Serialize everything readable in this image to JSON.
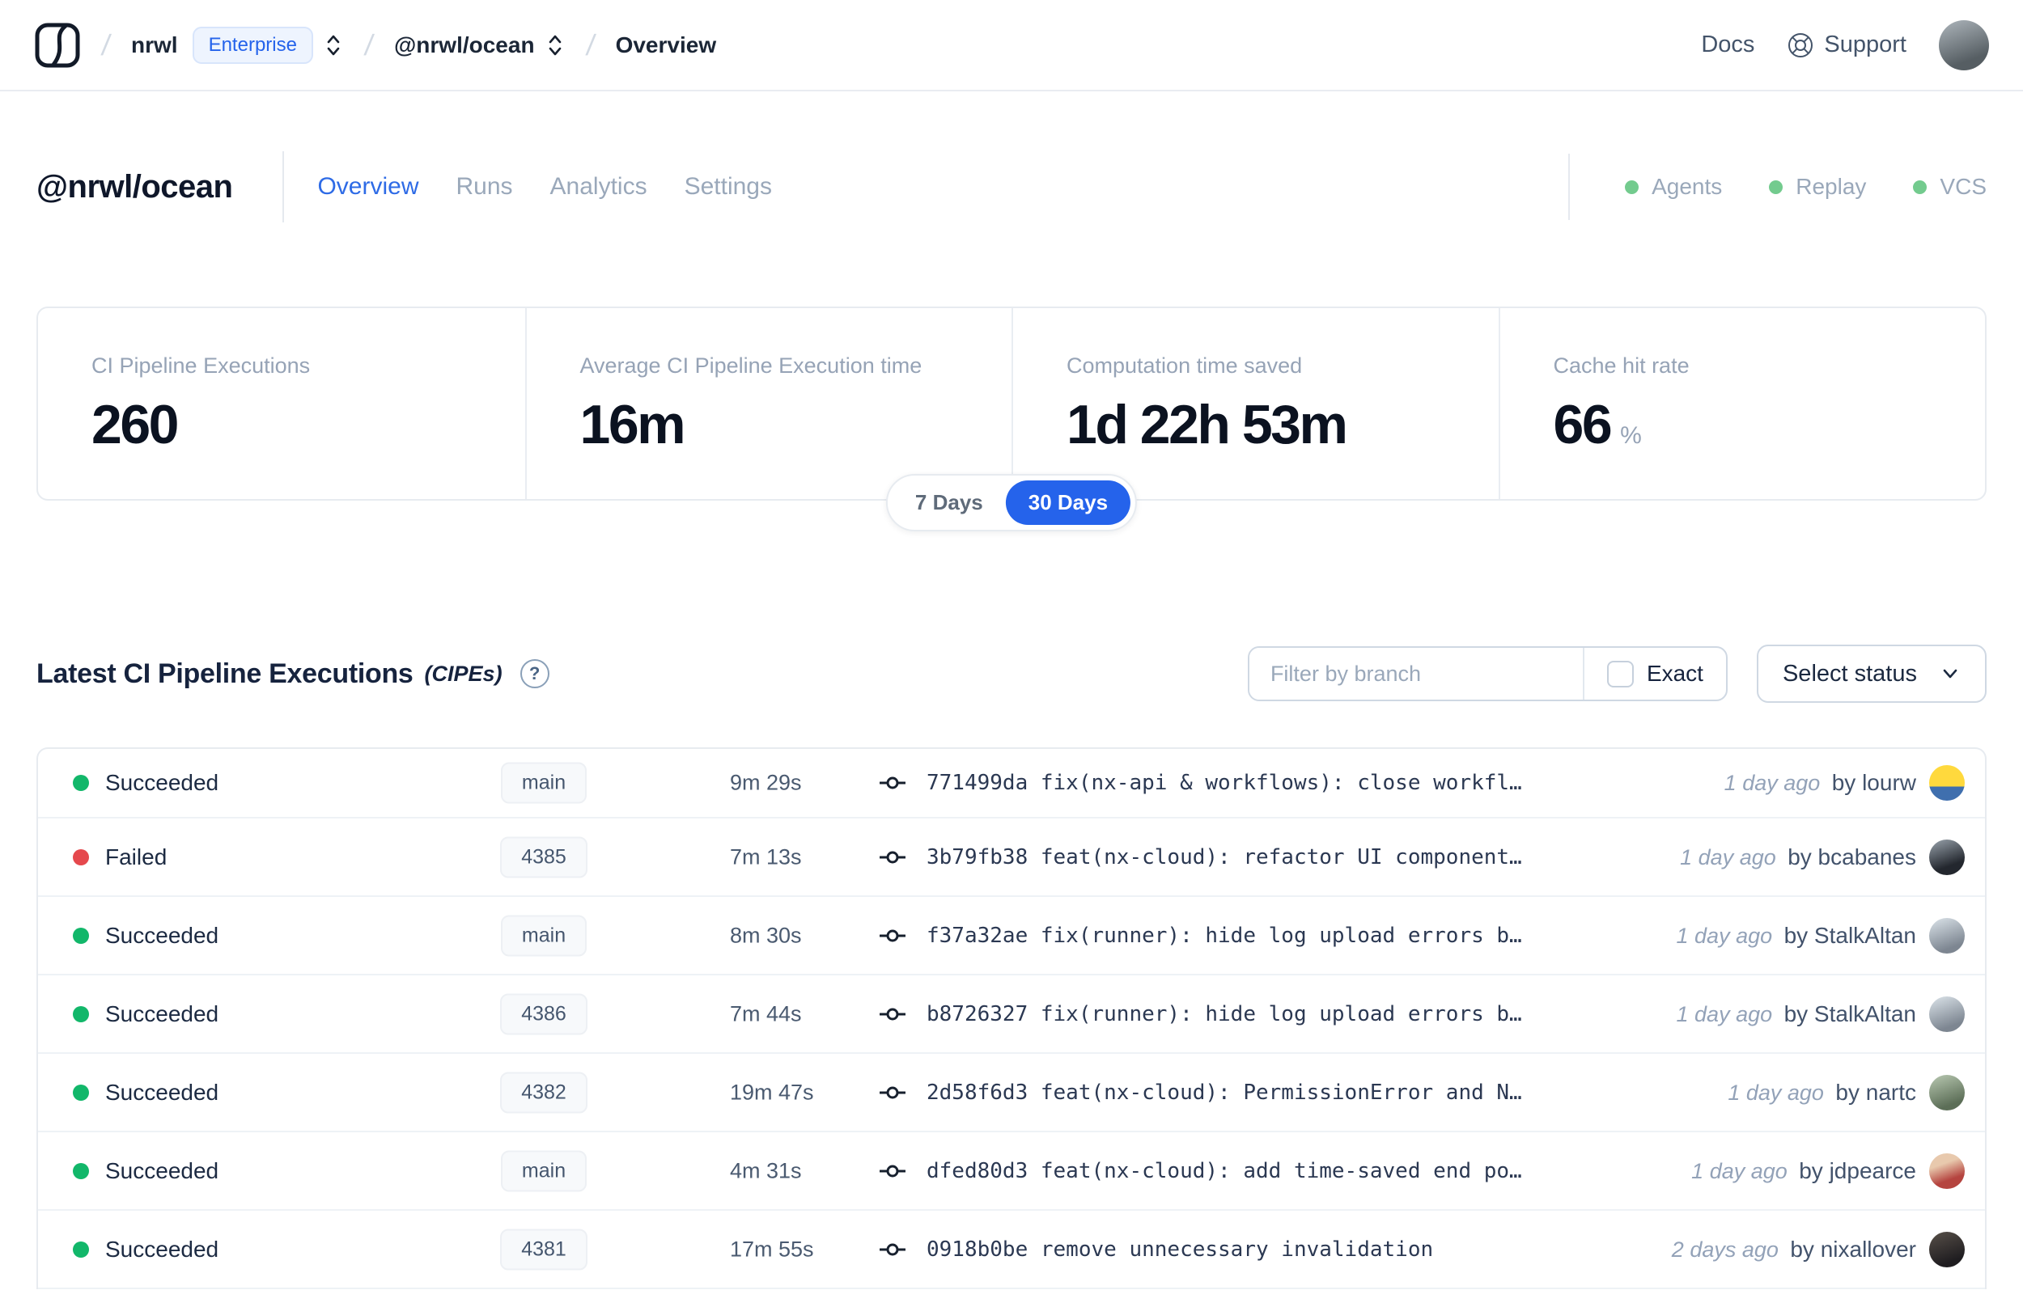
{
  "navbar": {
    "separator": "/",
    "org": "nrwl",
    "org_badge": "Enterprise",
    "workspace": "@nrwl/ocean",
    "page": "Overview",
    "docs_label": "Docs",
    "support_label": "Support"
  },
  "header": {
    "title": "@nrwl/ocean",
    "tabs": [
      {
        "label": "Overview",
        "active": true
      },
      {
        "label": "Runs",
        "active": false
      },
      {
        "label": "Analytics",
        "active": false
      },
      {
        "label": "Settings",
        "active": false
      }
    ],
    "indicators": [
      {
        "label": "Agents",
        "state": "green"
      },
      {
        "label": "Replay",
        "state": "green"
      },
      {
        "label": "VCS",
        "state": "green"
      }
    ]
  },
  "stats": {
    "cards": [
      {
        "label": "CI Pipeline Executions",
        "value": "260"
      },
      {
        "label": "Average CI Pipeline Execution time",
        "value": "16m"
      },
      {
        "label": "Computation time saved",
        "value": "1d 22h 53m"
      },
      {
        "label": "Cache hit rate",
        "value": "66",
        "suffix": "%"
      }
    ],
    "range_toggle": {
      "options": [
        "7 Days",
        "30 Days"
      ],
      "selected": "30 Days"
    }
  },
  "cipes": {
    "title": "Latest CI Pipeline Executions",
    "title_suffix": "(CIPEs)",
    "help_glyph": "?",
    "filter": {
      "placeholder": "Filter by branch",
      "exact_label": "Exact"
    },
    "status_select_label": "Select status",
    "rows": [
      {
        "status": "Succeeded",
        "status_color": "green",
        "branch": "main",
        "duration": "9m 29s",
        "commit": "771499da fix(nx-api & workflows): close workfl…",
        "time": "1 day ago",
        "author": "by lourw"
      },
      {
        "status": "Failed",
        "status_color": "red",
        "branch": "4385",
        "duration": "7m 13s",
        "commit": "3b79fb38 feat(nx-cloud): refactor UI component…",
        "time": "1 day ago",
        "author": "by bcabanes"
      },
      {
        "status": "Succeeded",
        "status_color": "green",
        "branch": "main",
        "duration": "8m 30s",
        "commit": "f37a32ae fix(runner): hide log upload errors b…",
        "time": "1 day ago",
        "author": "by StalkAltan"
      },
      {
        "status": "Succeeded",
        "status_color": "green",
        "branch": "4386",
        "duration": "7m 44s",
        "commit": "b8726327 fix(runner): hide log upload errors b…",
        "time": "1 day ago",
        "author": "by StalkAltan"
      },
      {
        "status": "Succeeded",
        "status_color": "green",
        "branch": "4382",
        "duration": "19m 47s",
        "commit": "2d58f6d3 feat(nx-cloud): PermissionError and N…",
        "time": "1 day ago",
        "author": "by nartc"
      },
      {
        "status": "Succeeded",
        "status_color": "green",
        "branch": "main",
        "duration": "4m 31s",
        "commit": "dfed80d3 feat(nx-cloud): add time-saved end po…",
        "time": "1 day ago",
        "author": "by jdpearce"
      },
      {
        "status": "Succeeded",
        "status_color": "green",
        "branch": "4381",
        "duration": "17m 55s",
        "commit": "0918b0be remove unnecessary invalidation",
        "time": "2 days ago",
        "author": "by nixallover"
      }
    ]
  },
  "icons": {
    "logo": "nx-cloud-logo",
    "breadcrumb_switcher": "chevron-up-down-icon",
    "support": "life-buoy-icon",
    "help": "question-circle-icon",
    "status_select": "chevron-down-icon",
    "commit": "git-commit-icon"
  },
  "colors": {
    "accent_blue": "#2563eb",
    "success_green": "#12b76a",
    "error_red": "#e5484d",
    "indicator_green": "#73cb8e"
  }
}
